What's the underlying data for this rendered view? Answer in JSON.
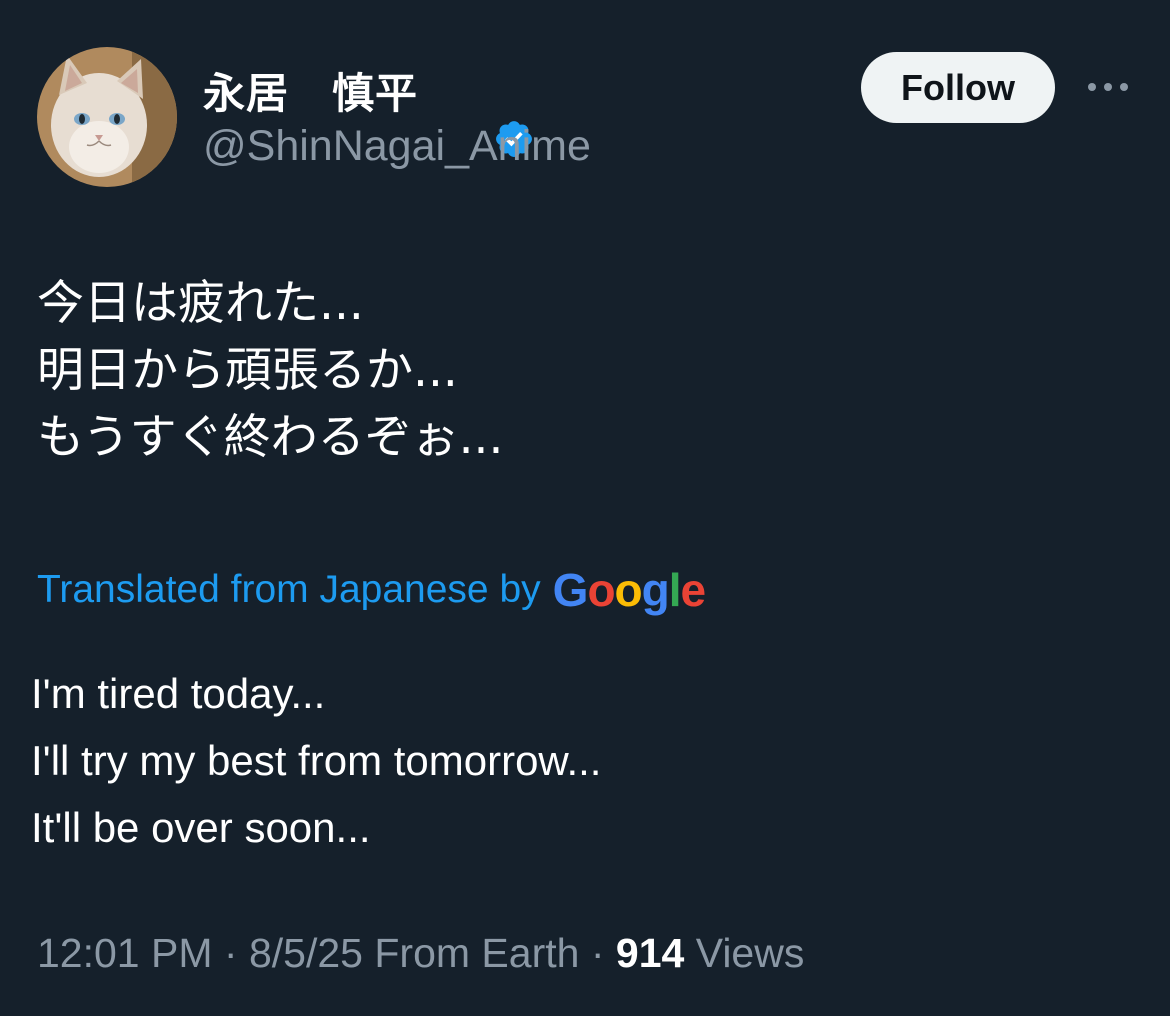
{
  "author": {
    "display_name": "永居　慎平",
    "handle": "@ShinNagai_Anime",
    "verified_icon": "verified-badge-icon",
    "avatar": "cat-avatar"
  },
  "actions": {
    "follow_label": "Follow",
    "more_icon": "more-horizontal-icon"
  },
  "tweet": {
    "original_lines": [
      "今日は疲れた...",
      "明日から頑張るか...",
      "もうすぐ終わるぞぉ..."
    ],
    "translation_notice": "Translated from Japanese by",
    "translation_provider": "Google",
    "translated_lines": [
      "I'm tired today...",
      "I'll try my best from tomorrow...",
      "It'll be over soon..."
    ]
  },
  "meta": {
    "time": "12:01 PM",
    "date": "8/5/25",
    "source": "From Earth",
    "separator": "·",
    "views_count": "914",
    "views_label": "Views"
  },
  "colors": {
    "background": "#15202b",
    "accent_blue": "#1d9bf0",
    "secondary_text": "#8b98a5",
    "google_blue": "#4285F4",
    "google_red": "#EA4335",
    "google_yellow": "#FBBC05",
    "google_green": "#34A853"
  }
}
